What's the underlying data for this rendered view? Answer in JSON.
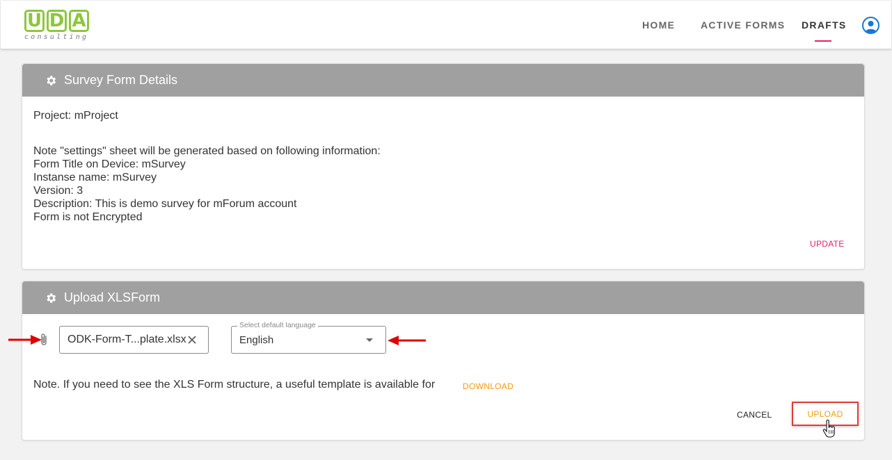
{
  "nav": {
    "logo_text": [
      "U",
      "D",
      "A"
    ],
    "logo_sub": "consulting",
    "items": [
      {
        "label": "HOME"
      },
      {
        "label": "ACTIVE FORMS"
      },
      {
        "label": "DRAFTS",
        "active": true
      }
    ],
    "accent_color": "#e91e63"
  },
  "details_card": {
    "title": "Survey Form Details",
    "icon": "gear-icon",
    "project_line": "Project: mProject",
    "lines": [
      "Note \"settings\" sheet will be generated based on following information:",
      "Form Title on Device: mSurvey",
      "Instanse name: mSurvey",
      "Version: 3",
      "Description: This is demo survey for mForum account",
      "Form is not Encrypted"
    ],
    "update_label": "UPDATE"
  },
  "upload_card": {
    "title": "Upload XLSForm",
    "icon": "gear-icon",
    "file_name": "ODK-Form-T...plate.xlsx",
    "language_label": "Select default language",
    "language_value": "English",
    "note": "Note. If you need to see the XLS Form structure, a useful template is available for",
    "download_label": "DOWNLOAD",
    "cancel_label": "CANCEL",
    "upload_label": "UPLOAD"
  },
  "colors": {
    "header_gray": "#a0a0a0",
    "orange": "#f39c12",
    "pink": "#e91e63",
    "arrow_red": "#e00000",
    "logo_green": "#8dc63f"
  }
}
